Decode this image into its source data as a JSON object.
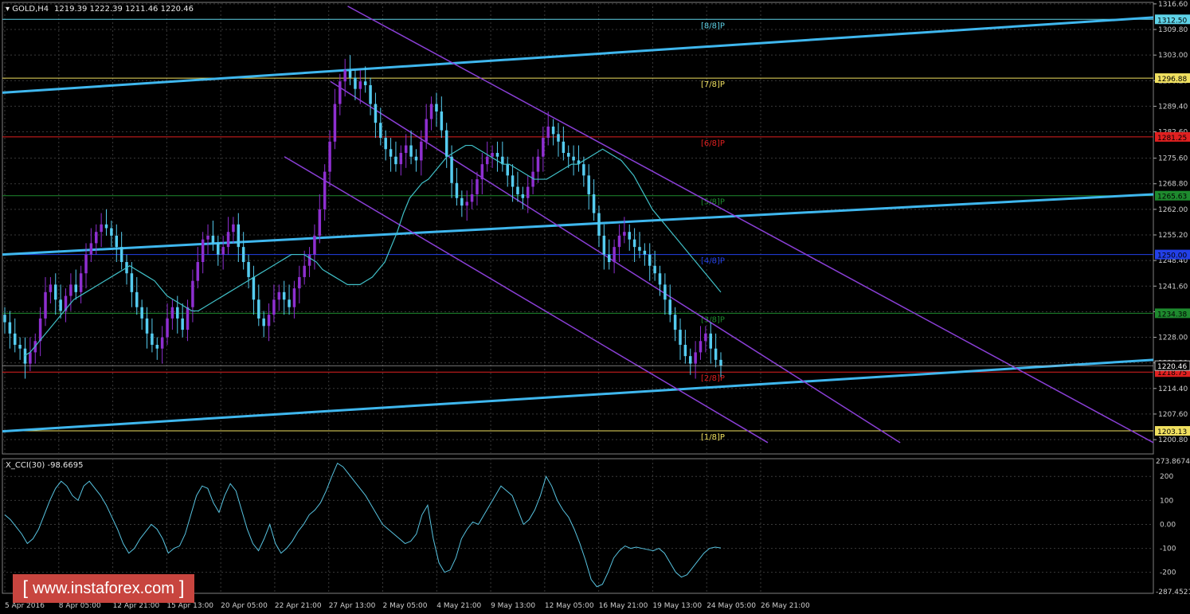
{
  "header": {
    "symbol": "GOLD,H4",
    "ohlc": "1219.39 1222.39 1211.46 1220.46"
  },
  "indicator": {
    "label": "X_CCI(30) -98.6695",
    "top_value": "273.8674",
    "bottom_value": "-287.4521",
    "ticks": [
      "200",
      "100",
      "0.00",
      "-100",
      "-200"
    ]
  },
  "watermark": {
    "text": "www.instaforex.com",
    "left_bracket": "[",
    "right_bracket": "]"
  },
  "colors": {
    "background": "#000000",
    "grid": "#3a3a3a",
    "bull_candle": "#8e2fd0",
    "bear_candle": "#55ccf0",
    "moving_average": "#40c0c8",
    "cci_line": "#57c3e0",
    "regression_channel": "#8a3fd6",
    "trend_lines": "#3fb7ee",
    "text": "#cfcfcf"
  },
  "chart_data": {
    "type": "candlestick",
    "title": "GOLD,H4",
    "y_range": [
      1197,
      1317
    ],
    "price_ticks": [
      "1316.60",
      "1309.80",
      "1303.00",
      "1296.20",
      "1289.40",
      "1282.60",
      "1275.60",
      "1268.80",
      "1262.00",
      "1255.20",
      "1248.40",
      "1241.60",
      "1234.80",
      "1228.00",
      "1221.20",
      "1214.40",
      "1207.60",
      "1200.80"
    ],
    "x_labels": [
      "5 Apr 2016",
      "8 Apr 05:00",
      "12 Apr 21:00",
      "15 Apr 13:00",
      "20 Apr 05:00",
      "22 Apr 21:00",
      "27 Apr 13:00",
      "2 May 05:00",
      "4 May 21:00",
      "9 May 13:00",
      "12 May 05:00",
      "16 May 21:00",
      "19 May 13:00",
      "24 May 05:00",
      "26 May 21:00"
    ],
    "current_price": "1220.46",
    "murrey_levels": [
      {
        "label": "[8/8]P",
        "price": "1312.50",
        "color": "#5fd3e8"
      },
      {
        "label": "[7/8]P",
        "price": "1296.88",
        "color": "#f0e060"
      },
      {
        "label": "[6/8]P",
        "price": "1281.25",
        "color": "#e02020"
      },
      {
        "label": "[5/8]P",
        "price": "1265.63",
        "color": "#1e8a2e"
      },
      {
        "label": "[4/8]P",
        "price": "1250.00",
        "color": "#2340e8"
      },
      {
        "label": "[3/8]P",
        "price": "1234.38",
        "color": "#1e8a2e"
      },
      {
        "label": "[2/8]P",
        "price": "1218.75",
        "color": "#e02020"
      },
      {
        "label": "[1/8]P",
        "price": "1203.13",
        "color": "#f0e060"
      }
    ],
    "closes": [
      1232,
      1229,
      1226,
      1225,
      1221,
      1224,
      1227,
      1233,
      1240,
      1242,
      1238,
      1235,
      1239,
      1242,
      1240,
      1245,
      1250,
      1253,
      1256,
      1258,
      1257,
      1255,
      1252,
      1248,
      1245,
      1240,
      1236,
      1233,
      1229,
      1226,
      1225,
      1228,
      1233,
      1236,
      1233,
      1230,
      1236,
      1243,
      1248,
      1254,
      1255,
      1253,
      1250,
      1252,
      1256,
      1258,
      1252,
      1248,
      1244,
      1238,
      1233,
      1231,
      1234,
      1238,
      1240,
      1238,
      1236,
      1241,
      1244,
      1247,
      1250,
      1255,
      1262,
      1272,
      1280,
      1290,
      1296,
      1299,
      1297,
      1294,
      1296,
      1295,
      1290,
      1285,
      1281,
      1278,
      1276,
      1274,
      1277,
      1279,
      1276,
      1275,
      1280,
      1286,
      1290,
      1288,
      1283,
      1276,
      1269,
      1265,
      1263,
      1264,
      1266,
      1270,
      1274,
      1276,
      1277,
      1276,
      1274,
      1271,
      1268,
      1266,
      1265,
      1268,
      1272,
      1276,
      1281,
      1284,
      1282,
      1280,
      1277,
      1276,
      1275,
      1274,
      1271,
      1266,
      1261,
      1255,
      1250,
      1248,
      1252,
      1255,
      1256,
      1254,
      1252,
      1251,
      1250,
      1247,
      1245,
      1242,
      1238,
      1234,
      1230,
      1226,
      1223,
      1221,
      1224,
      1227,
      1229,
      1225,
      1222,
      1220.46
    ],
    "moving_average": [
      1223,
      1224,
      1226,
      1228,
      1230,
      1232,
      1234,
      1236,
      1238,
      1239,
      1240,
      1241,
      1242,
      1243,
      1244,
      1245,
      1246,
      1247,
      1246,
      1245,
      1244,
      1243,
      1241,
      1239,
      1238,
      1237,
      1236,
      1235,
      1235,
      1236,
      1237,
      1238,
      1239,
      1240,
      1241,
      1242,
      1243,
      1244,
      1245,
      1246,
      1247,
      1248,
      1249,
      1250,
      1250,
      1250,
      1249,
      1248,
      1246,
      1245,
      1244,
      1243,
      1242,
      1242,
      1242,
      1243,
      1244,
      1246,
      1248,
      1252,
      1256,
      1261,
      1265,
      1267,
      1269,
      1270,
      1272,
      1274,
      1276,
      1277,
      1278,
      1279,
      1279,
      1278,
      1277,
      1276,
      1275,
      1274,
      1274,
      1273,
      1272,
      1271,
      1270,
      1270,
      1270,
      1271,
      1272,
      1273,
      1274,
      1274,
      1275,
      1276,
      1277,
      1278,
      1277,
      1276,
      1275,
      1273,
      1271,
      1268,
      1265,
      1262,
      1260,
      1258,
      1256,
      1254,
      1252,
      1250,
      1248,
      1246,
      1244,
      1242,
      1240
    ],
    "regression_channel": {
      "upper": [
        [
          0.3,
          1316
        ],
        [
          1.0,
          1200
        ]
      ],
      "middle": [
        [
          0.285,
          1296
        ],
        [
          0.78,
          1200
        ]
      ],
      "lower": [
        [
          0.245,
          1276
        ],
        [
          0.665,
          1200
        ]
      ]
    },
    "trend_lines": [
      {
        "from": [
          0.0,
          1293
        ],
        "to": [
          1.0,
          1313
        ]
      },
      {
        "from": [
          0.0,
          1250
        ],
        "to": [
          1.0,
          1266
        ]
      },
      {
        "from": [
          0.0,
          1203
        ],
        "to": [
          1.0,
          1222
        ]
      }
    ],
    "cci": {
      "series_label": "X_CCI(30)",
      "y_range": [
        -287.4521,
        273.8674
      ],
      "values": [
        40,
        20,
        -10,
        -40,
        -80,
        -60,
        -20,
        40,
        100,
        150,
        180,
        160,
        120,
        100,
        160,
        180,
        150,
        120,
        80,
        30,
        -20,
        -80,
        -120,
        -100,
        -60,
        -30,
        0,
        -20,
        -60,
        -120,
        -100,
        -90,
        -40,
        40,
        120,
        160,
        150,
        90,
        50,
        120,
        170,
        140,
        60,
        -20,
        -80,
        -110,
        -60,
        0,
        -80,
        -120,
        -100,
        -70,
        -30,
        0,
        40,
        60,
        90,
        140,
        200,
        255,
        240,
        210,
        180,
        150,
        120,
        80,
        40,
        0,
        -20,
        -40,
        -60,
        -80,
        -70,
        -40,
        40,
        80,
        -60,
        -160,
        -200,
        -190,
        -140,
        -60,
        -20,
        10,
        0,
        40,
        80,
        120,
        160,
        140,
        120,
        60,
        0,
        20,
        60,
        120,
        200,
        160,
        100,
        60,
        30,
        -20,
        -80,
        -150,
        -230,
        -260,
        -250,
        -200,
        -140,
        -110,
        -90,
        -100,
        -95,
        -100,
        -105,
        -110,
        -100,
        -120,
        -160,
        -200,
        -220,
        -210,
        -180,
        -150,
        -120,
        -100,
        -95,
        -98.67
      ]
    }
  }
}
